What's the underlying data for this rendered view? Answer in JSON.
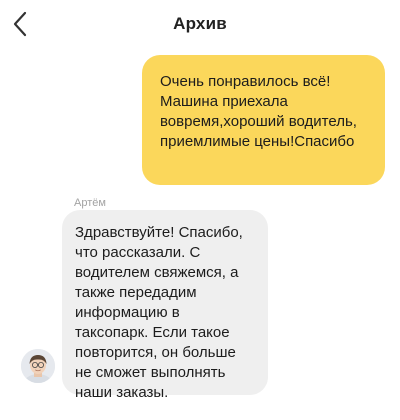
{
  "header": {
    "title": "Архив",
    "back_icon": "chevron-left-icon"
  },
  "messages": [
    {
      "direction": "outgoing",
      "text": "Очень понравилось всё! Машина приехала вовремя,хороший водитель, приемлимые цены!Спасибо",
      "bubble_color": "#fbd75b"
    },
    {
      "direction": "incoming",
      "sender": "Артём",
      "text": "Здравствуйте! Спасибо, что рассказали. С водителем свяжемся, а также передадим информацию в таксопарк. Если такое повторится, он больше не сможет выполнять наши заказы.",
      "bubble_color": "#efefef",
      "avatar_icon": "user-avatar-icon"
    }
  ],
  "colors": {
    "background": "#ffffff",
    "accent_yellow": "#fbd75b",
    "incoming_bubble": "#efefef",
    "sender_name": "#a3a3a3"
  }
}
